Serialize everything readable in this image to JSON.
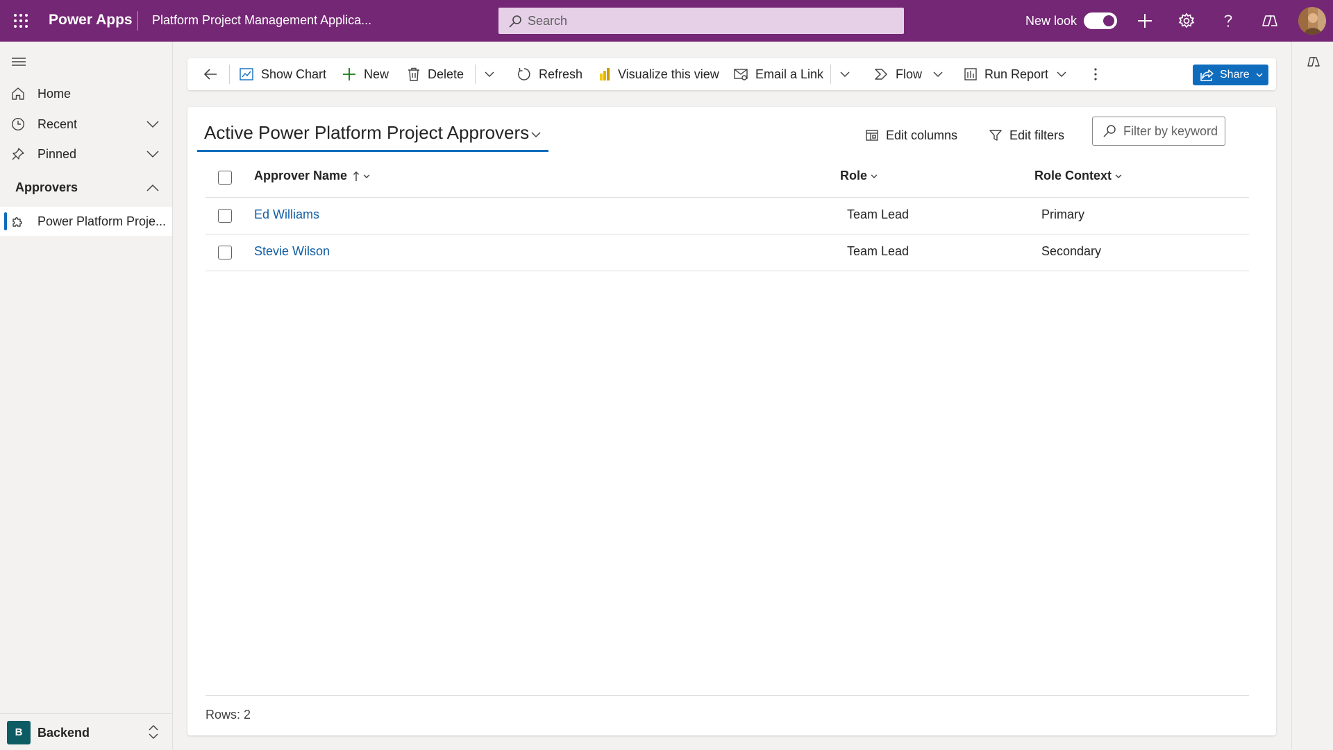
{
  "header": {
    "app_name": "Power Apps",
    "app_title": "Platform Project Management Applica...",
    "search_placeholder": "Search",
    "new_look_label": "New look",
    "new_look_on": true,
    "brand_color": "#742774",
    "icons": [
      "app-launcher-icon",
      "search-icon",
      "plus-icon",
      "settings-gear-icon",
      "help-icon",
      "copilot-icon",
      "user-avatar"
    ]
  },
  "nav": {
    "items": [
      {
        "label": "Home",
        "icon": "home-icon"
      },
      {
        "label": "Recent",
        "icon": "clock-icon",
        "expandable": true
      },
      {
        "label": "Pinned",
        "icon": "pin-icon",
        "expandable": true
      }
    ],
    "group": {
      "label": "Approvers",
      "expanded": true
    },
    "entity": {
      "label": "Power Platform Proje...",
      "icon": "puzzle-icon",
      "selected": true
    },
    "area": {
      "badge": "B",
      "label": "Backend",
      "badge_color": "#0e5c63"
    }
  },
  "commands": {
    "show_chart": "Show Chart",
    "new": "New",
    "delete": "Delete",
    "refresh": "Refresh",
    "visualize": "Visualize this view",
    "email_link": "Email a Link",
    "flow": "Flow",
    "run_report": "Run Report",
    "share": "Share",
    "accent_color": "#0f6cbd"
  },
  "view": {
    "title": "Active Power Platform Project Approvers",
    "edit_columns": "Edit columns",
    "edit_filters": "Edit filters",
    "filter_placeholder": "Filter by keyword"
  },
  "grid": {
    "columns": [
      {
        "label": "Approver Name",
        "sorted": "ascending"
      },
      {
        "label": "Role"
      },
      {
        "label": "Role Context"
      }
    ],
    "rows": [
      {
        "name": "Ed Williams",
        "role": "Team Lead",
        "context": "Primary"
      },
      {
        "name": "Stevie Wilson",
        "role": "Team Lead",
        "context": "Secondary"
      }
    ],
    "rows_count": "Rows: 2"
  }
}
